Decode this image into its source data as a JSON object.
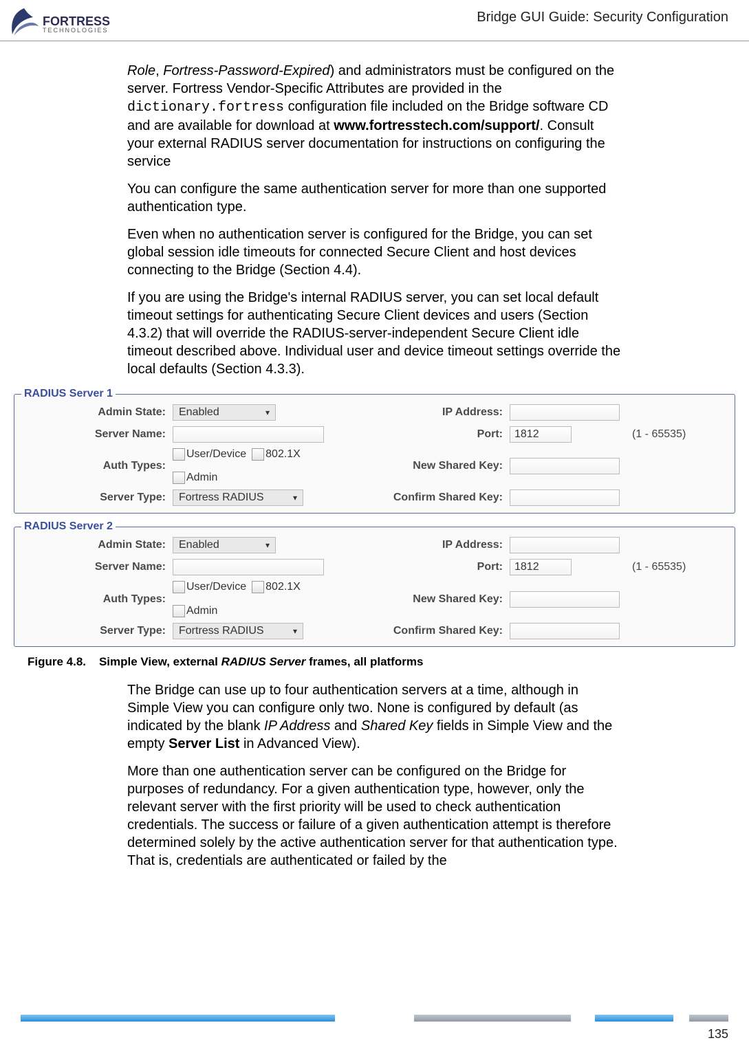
{
  "header": {
    "logo_main": "FORTRESS",
    "logo_sub": "TECHNOLOGIES",
    "title": "Bridge GUI Guide: Security Configuration"
  },
  "para1_lead_italic": "Role",
  "para1_comma": ", ",
  "para1_italic2": "Fortress-Password-Expired",
  "para1_a": ") and administrators must be configured on the server. Fortress Vendor-Specific Attributes are provided in the ",
  "para1_mono": "dictionary.fortress",
  "para1_b": " configuration file included on the Bridge software CD and are available for download at ",
  "para1_bold_url": "www.fortresstech.com/support/",
  "para1_c": ". Consult your external RADIUS server documentation for instructions on configuring the service",
  "para2": "You can configure the same authentication server for more than one supported authentication type.",
  "para3": "Even when no authentication server is configured for the Bridge, you can set global session idle timeouts for connected Secure Client and host devices connecting to the Bridge (Section 4.4).",
  "para4": "If you are using the Bridge's internal RADIUS server, you can set local default timeout settings for authenticating Secure Client devices and users (Section 4.3.2) that will override the RADIUS-server-independent Secure Client idle timeout described above. Individual user and device timeout settings override the local defaults (Section 4.3.3).",
  "radius": [
    {
      "legend": "RADIUS Server 1",
      "admin_state_label": "Admin State:",
      "admin_state_value": "Enabled",
      "ip_label": "IP Address:",
      "server_name_label": "Server Name:",
      "port_label": "Port:",
      "port_value": "1812",
      "port_hint": "(1 - 65535)",
      "auth_types_label": "Auth Types:",
      "cb_user_device": "User/Device",
      "cb_8021x": "802.1X",
      "cb_admin": "Admin",
      "new_key_label": "New Shared Key:",
      "server_type_label": "Server Type:",
      "server_type_value": "Fortress RADIUS",
      "confirm_key_label": "Confirm Shared Key:"
    },
    {
      "legend": "RADIUS Server 2",
      "admin_state_label": "Admin State:",
      "admin_state_value": "Enabled",
      "ip_label": "IP Address:",
      "server_name_label": "Server Name:",
      "port_label": "Port:",
      "port_value": "1812",
      "port_hint": "(1 - 65535)",
      "auth_types_label": "Auth Types:",
      "cb_user_device": "User/Device",
      "cb_8021x": "802.1X",
      "cb_admin": "Admin",
      "new_key_label": "New Shared Key:",
      "server_type_label": "Server Type:",
      "server_type_value": "Fortress RADIUS",
      "confirm_key_label": "Confirm Shared Key:"
    }
  ],
  "figure": {
    "num": "Figure 4.8.",
    "text_a": "Simple View, external ",
    "italic": "RADIUS Server",
    "text_b": " frames, all platforms"
  },
  "para5_a": "The Bridge can use up to four authentication servers at a time, although in Simple View you can configure only two. None is configured by default (as indicated by the blank ",
  "para5_i1": "IP Address",
  "para5_b": " and ",
  "para5_i2": "Shared Key",
  "para5_c": " fields in Simple View and the empty ",
  "para5_bold": "Server List",
  "para5_d": " in Advanced View).",
  "para6": "More than one authentication server can be configured on the Bridge for purposes of redundancy. For a given authentication type, however, only the relevant server with the first priority will be used to check authentication credentials. The success or failure of a given authentication attempt is therefore determined solely by the active authentication server for that authentication type. That is, credentials are authenticated or failed by the",
  "pagenum": "135"
}
